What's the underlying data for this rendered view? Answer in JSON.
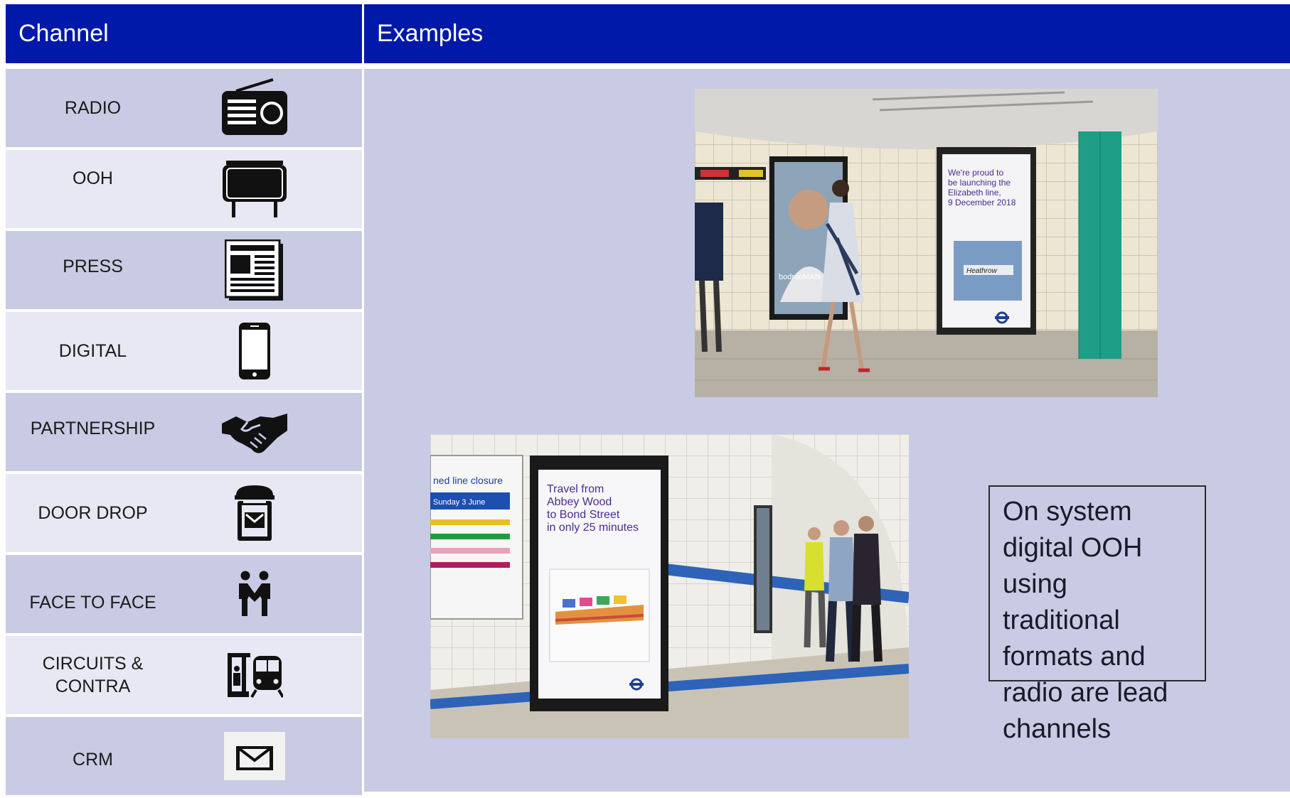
{
  "header": {
    "channel": "Channel",
    "examples": "Examples"
  },
  "channels": [
    {
      "label": "RADIO",
      "icon": "radio-icon"
    },
    {
      "label": "OOH",
      "icon": "billboard-icon"
    },
    {
      "label": "PRESS",
      "icon": "newspaper-icon"
    },
    {
      "label": "DIGITAL",
      "icon": "smartphone-icon"
    },
    {
      "label": "PARTNERSHIP",
      "icon": "handshake-icon"
    },
    {
      "label": "DOOR DROP",
      "icon": "letterbox-icon"
    },
    {
      "label": "FACE TO FACE",
      "icon": "people-icon"
    },
    {
      "label": "CIRCUITS & CONTRA",
      "icon": "train-station-icon"
    },
    {
      "label": "CRM",
      "icon": "envelope-icon"
    }
  ],
  "example1": {
    "poster": {
      "line1": "We're proud to",
      "line2": "be launching the",
      "line3": "Elizabeth line,",
      "line4": "9 December 2018",
      "sign": "Heathrow"
    },
    "left_poster": "bodrooMAN"
  },
  "example2": {
    "notice": {
      "title": "ned line closure",
      "date": "Sunday 3 June"
    },
    "poster": {
      "line1": "Travel from",
      "line2": "Abbey Wood",
      "line3": "to Bond Street",
      "line4": "in only 25 minutes"
    }
  },
  "callout": "On system digital OOH using traditional formats and radio are lead channels",
  "colors": {
    "header": "#0019a8",
    "row_dark": "#c8cbe3",
    "row_light": "#e7e8f3",
    "poster_text": "#4b2d8f"
  }
}
